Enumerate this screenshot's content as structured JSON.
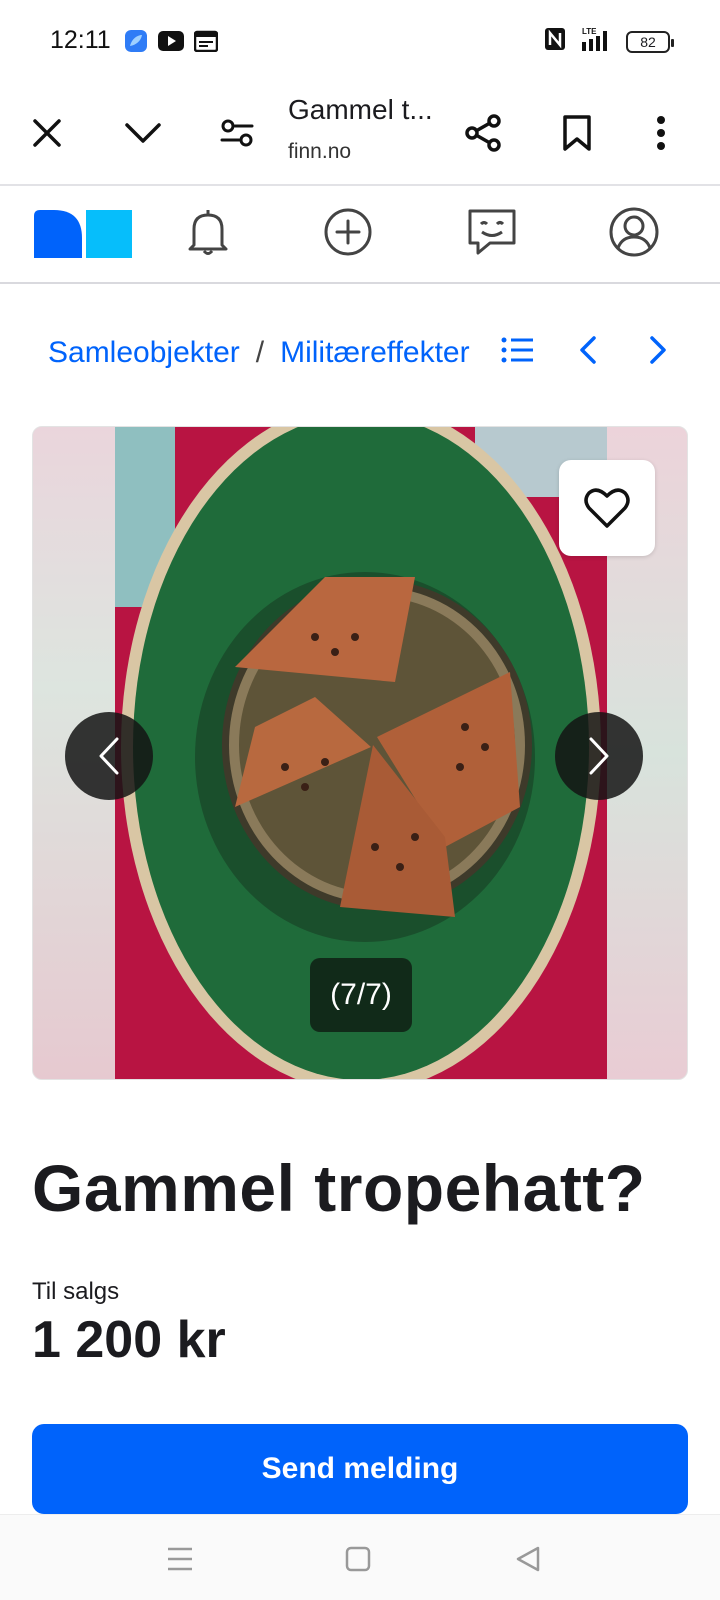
{
  "status_bar": {
    "time": "12:11",
    "battery": "82",
    "network": "LTE",
    "left_icons": [
      "browser-app-icon",
      "youtube-icon",
      "calendar-icon"
    ],
    "right_icons": [
      "nfc-icon",
      "signal-icon",
      "battery-icon"
    ]
  },
  "browser": {
    "page_title": "Gammel t...",
    "url": "finn.no",
    "icons": [
      "close-icon",
      "chevron-down-icon",
      "page-settings-icon",
      "share-icon",
      "bookmark-icon",
      "more-vertical-icon"
    ]
  },
  "finn_header": {
    "icons": [
      "finn-logo",
      "notifications-bell-icon",
      "new-ad-plus-icon",
      "messages-icon",
      "profile-icon"
    ]
  },
  "breadcrumb": {
    "items": [
      "Samleobjekter",
      "Militæreffekter"
    ],
    "separator": "/",
    "icons": [
      "list-icon",
      "prev-arrow-icon",
      "next-arrow-icon"
    ]
  },
  "gallery": {
    "counter": "(7/7)",
    "icons": [
      "heart-icon",
      "gallery-prev-icon",
      "gallery-next-icon"
    ]
  },
  "ad": {
    "title": "Gammel tropehatt?",
    "price_label": "Til salgs",
    "price": "1 200 kr",
    "send_button": "Send melding"
  },
  "colors": {
    "brand_blue": "#0063fb",
    "brand_light_blue": "#06befb",
    "text": "#1b1b1f"
  }
}
